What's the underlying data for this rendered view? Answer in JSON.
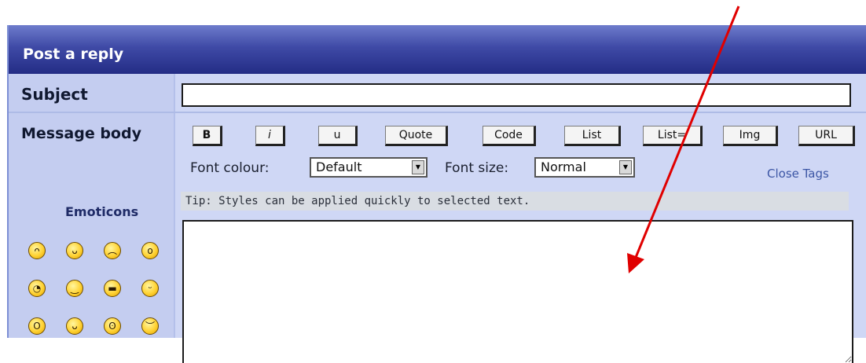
{
  "panel": {
    "title": "Post a reply"
  },
  "form": {
    "subject_label": "Subject",
    "message_label": "Message body",
    "emoticons_label": "Emoticons",
    "subject_value": "",
    "message_value": ""
  },
  "toolbar": {
    "buttons": [
      "B",
      "i",
      "u",
      "Quote",
      "Code",
      "List",
      "List=",
      "Img",
      "URL"
    ],
    "font_colour_label": "Font colour:",
    "font_colour_value": "Default",
    "font_size_label": "Font size:",
    "font_size_value": "Normal",
    "close_tags": "Close Tags"
  },
  "tip": {
    "text": "Tip: Styles can be applied quickly to selected text."
  },
  "emoticons": [
    "laughing",
    "grin",
    "sad",
    "surprised",
    "rolleyes",
    "wink",
    "cool",
    "happy",
    "shocked",
    "smile",
    "eek",
    "frown"
  ],
  "annotation": {
    "arrow_color": "#e00000"
  }
}
